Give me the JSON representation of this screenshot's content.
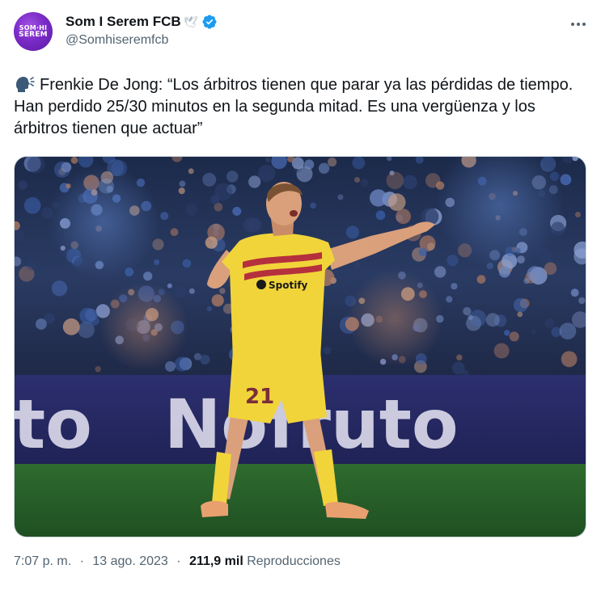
{
  "author": {
    "display_name": "Som I Serem FCB",
    "name_emoji": "🕊",
    "handle": "@Somhiseremfcb",
    "avatar_text_line1": "SOM·HI",
    "avatar_text_line2": "SEREM",
    "verified": true
  },
  "tweet": {
    "speaking_icon": "speaking-head-emoji",
    "text": "Frenkie De Jong: “Los árbitros tienen que parar ya las pérdidas de tiempo. Han perdido 25/30 minutos en la segunda mitad. Es una vergüenza y los árbitros tienen que actuar”"
  },
  "media": {
    "player_number": "21",
    "sponsor": "Spotify",
    "board_text": "Nofruto",
    "board_text_left": "to"
  },
  "meta": {
    "time": "7:07 p. m.",
    "date": "13 ago. 2023",
    "separator": "·",
    "views_count": "211,9 mil",
    "views_label": "Reproducciones"
  },
  "colors": {
    "text": "#0f1419",
    "secondary": "#536471",
    "verified": "#1d9bf0",
    "border": "#cfd9de"
  }
}
